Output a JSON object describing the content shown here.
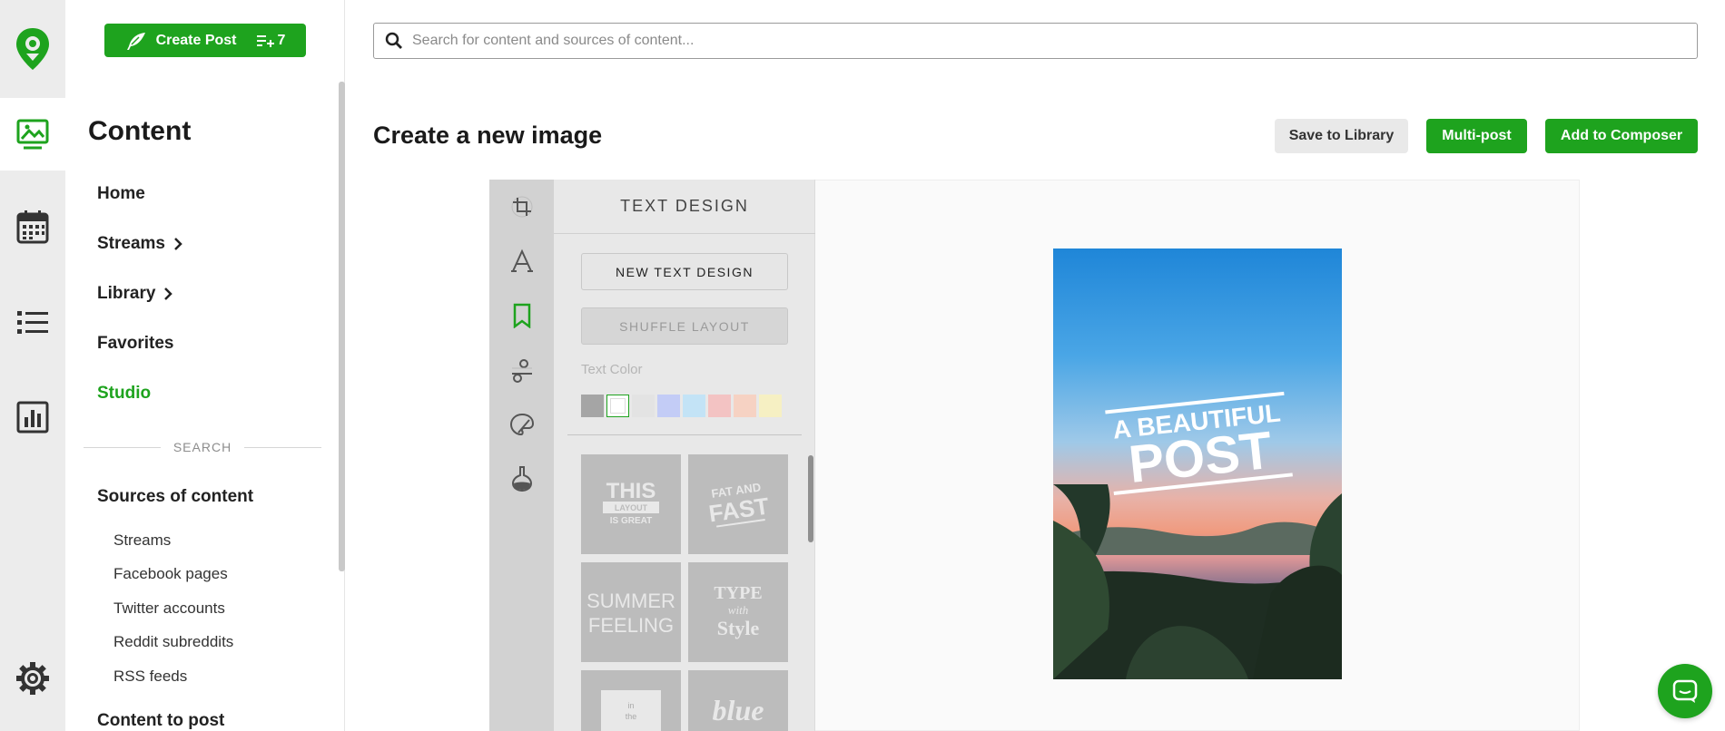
{
  "app": {
    "brand_color": "#1ea31e"
  },
  "rail": {
    "items": [
      {
        "icon": "image-icon",
        "active": true
      },
      {
        "icon": "calendar-icon"
      },
      {
        "icon": "list-icon"
      },
      {
        "icon": "analytics-icon"
      },
      {
        "icon": "gear-icon"
      }
    ]
  },
  "nav": {
    "create_label": "Create Post",
    "queue_count": "7",
    "title": "Content",
    "items": [
      {
        "label": "Home"
      },
      {
        "label": "Streams"
      },
      {
        "label": "Library"
      },
      {
        "label": "Favorites"
      },
      {
        "label": "Studio"
      }
    ],
    "search_section": "SEARCH",
    "sources_title": "Sources of content",
    "sources": [
      "Streams",
      "Facebook pages",
      "Twitter accounts",
      "Reddit subreddits",
      "RSS feeds"
    ],
    "content_to_post": "Content to post"
  },
  "search": {
    "placeholder": "Search for content and sources of content..."
  },
  "page": {
    "title": "Create a new image",
    "save_label": "Save to Library",
    "multipost_label": "Multi-post",
    "composer_label": "Add to Composer"
  },
  "editor": {
    "panel_title": "TEXT DESIGN",
    "new_design_label": "NEW TEXT DESIGN",
    "shuffle_label": "SHUFFLE LAYOUT",
    "text_color_label": "Text Color",
    "swatches": [
      "#a5a5a5",
      "#ffffff",
      "#e3e3e3",
      "#c3ccf6",
      "#c3e3f6",
      "#f3c3c3",
      "#f6d2c3",
      "#f6f0c3"
    ],
    "thumbnails": [
      {
        "l1": "THIS",
        "l2": "LAYOUT",
        "l3": "IS GREAT"
      },
      {
        "l1": "FAT AND",
        "l2": "FAST"
      },
      {
        "l1": "SUMMER",
        "l2": "FEELING"
      },
      {
        "l1": "TYPE",
        "l2": "with",
        "l3": "Style"
      },
      {
        "l1": "in",
        "l2": "the"
      },
      {
        "l1": "blue"
      }
    ],
    "image_text": {
      "line1": "A BEAUTIFUL",
      "line2": "POST"
    }
  }
}
